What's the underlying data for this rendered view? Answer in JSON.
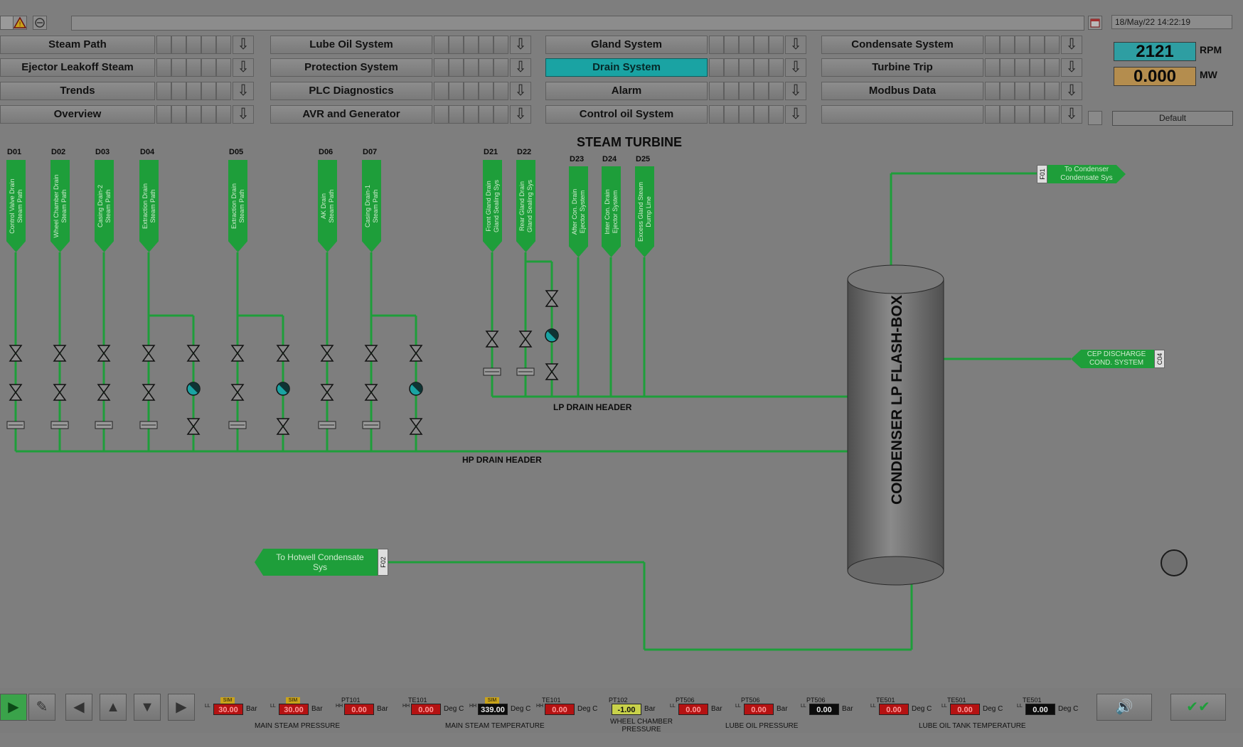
{
  "topbar": {
    "datetime": "18/May/22 14:22:19"
  },
  "nav": {
    "col1": [
      "Steam Path",
      "Ejector Leakoff Steam",
      "Trends",
      "Overview"
    ],
    "col2": [
      "Lube Oil System",
      "Protection System",
      "PLC Diagnostics",
      "AVR and Generator"
    ],
    "col3": [
      "Gland System",
      "Drain System",
      "Alarm",
      "Control oil System"
    ],
    "col4": [
      "Condensate System",
      "Turbine Trip",
      "Modbus Data",
      ""
    ],
    "active": "Drain System",
    "arrow_glyph": "⇩"
  },
  "readouts": {
    "rpm_value": "2121",
    "rpm_unit": "RPM",
    "mw_value": "0.000",
    "mw_unit": "MW",
    "profile": "Default"
  },
  "diagram": {
    "title": "STEAM TURBINE",
    "drains": [
      {
        "id": "D01",
        "label": "Control Valve Drain\nSteam Path"
      },
      {
        "id": "D02",
        "label": "Wheel Chamber Drain\nSteam Path"
      },
      {
        "id": "D03",
        "label": "Casing Drain-2\nSteam Path"
      },
      {
        "id": "D04",
        "label": "Extraction Drain\nSteam Path"
      },
      {
        "id": "D05",
        "label": "Extraction Drain\nSteam Path"
      },
      {
        "id": "D06",
        "label": "AK Drain\nSteam Path"
      },
      {
        "id": "D07",
        "label": "Casing Drain-1\nSteam Path"
      },
      {
        "id": "D21",
        "label": "Front Gland Drain\nGland Sealing Sys"
      },
      {
        "id": "D22",
        "label": "Rear Gland Drain\nGland Sealing Sys"
      },
      {
        "id": "D23",
        "label": "After Con. Drain\nEjector System"
      },
      {
        "id": "D24",
        "label": "Inter Con. Drain\nEjector System"
      },
      {
        "id": "D25",
        "label": "Excess Gland Steam\nDump Line"
      }
    ],
    "lp_header": "LP DRAIN HEADER",
    "hp_header": "HP DRAIN HEADER",
    "vessel": "CONDENSER LP FLASH-BOX",
    "to_condenser": {
      "text": "To Condenser\nCondensate Sys",
      "tag": "F01"
    },
    "cep_discharge": {
      "text": "CEP DISCHARGE\nCOND. SYSTEM",
      "tag": "C04"
    },
    "to_hotwell": {
      "text": "To Hotwell Condensate\nSys",
      "tag": "F02"
    }
  },
  "bottom": {
    "meters": [
      {
        "tag": "",
        "lim": "LL",
        "value": "30.00",
        "unit": "Bar",
        "style": "red",
        "badge": "SIM"
      },
      {
        "tag": "",
        "lim": "LL",
        "value": "30.00",
        "unit": "Bar",
        "style": "red",
        "badge": "SIM"
      },
      {
        "tag": "PT101",
        "lim": "HH",
        "value": "0.00",
        "unit": "Bar",
        "style": "red",
        "badge": ""
      },
      {
        "tag": "TE101",
        "lim": "HH",
        "value": "0.00",
        "unit": "Deg C",
        "style": "red",
        "badge": ""
      },
      {
        "tag": "",
        "lim": "HH",
        "value": "339.00",
        "unit": "Deg C",
        "style": "blk",
        "badge": "SIM"
      },
      {
        "tag": "TE101",
        "lim": "HH",
        "value": "0.00",
        "unit": "Deg C",
        "style": "red",
        "badge": ""
      },
      {
        "tag": "PT102",
        "lim": "",
        "value": "-1.00",
        "unit": "Bar",
        "style": "yel",
        "badge": ""
      },
      {
        "tag": "PT506",
        "lim": "LL",
        "value": "0.00",
        "unit": "Bar",
        "style": "red",
        "badge": ""
      },
      {
        "tag": "PT506",
        "lim": "LL",
        "value": "0.00",
        "unit": "Bar",
        "style": "red",
        "badge": ""
      },
      {
        "tag": "PT506",
        "lim": "LL",
        "value": "0.00",
        "unit": "Bar",
        "style": "blk",
        "badge": ""
      },
      {
        "tag": "TE501",
        "lim": "LL",
        "value": "0.00",
        "unit": "Deg C",
        "style": "red",
        "badge": ""
      },
      {
        "tag": "TE501",
        "lim": "LL",
        "value": "0.00",
        "unit": "Deg C",
        "style": "red",
        "badge": ""
      },
      {
        "tag": "TE501",
        "lim": "LL",
        "value": "0.00",
        "unit": "Deg C",
        "style": "blk",
        "badge": ""
      }
    ],
    "groups": [
      "MAIN STEAM PRESSURE",
      "MAIN STEAM TEMPERATURE",
      "WHEEL CHAMBER\nPRESSURE",
      "LUBE OIL PRESSURE",
      "LUBE OIL TANK TEMPERATURE"
    ]
  },
  "colors": {
    "pipe": "#1e9e3a",
    "active_button": "#1aa3a3",
    "rpm_bg": "#2e9ea2",
    "mw_bg": "#b48d4e"
  }
}
